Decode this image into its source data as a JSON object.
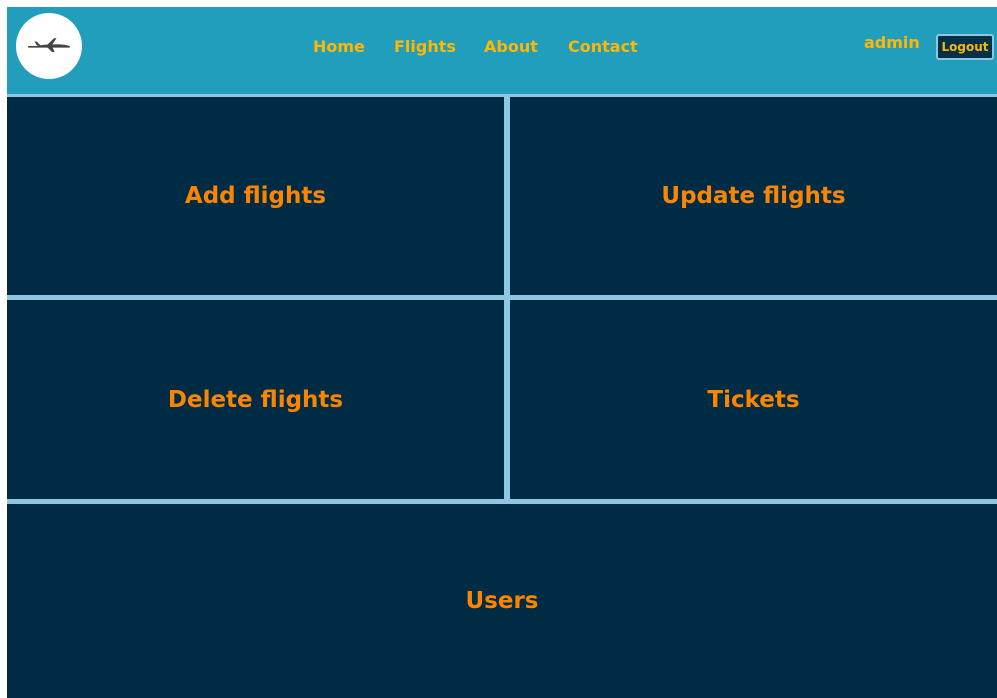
{
  "navbar": {
    "logo_icon": "airplane-icon",
    "links": [
      {
        "label": "Home"
      },
      {
        "label": "Flights"
      },
      {
        "label": "About"
      },
      {
        "label": "Contact"
      }
    ],
    "username": "admin",
    "logout_label": "Logout"
  },
  "tiles": {
    "add": "Add flights",
    "update": "Update flights",
    "delete": "Delete flights",
    "tickets": "Tickets",
    "users": "Users"
  },
  "colors": {
    "navbar_bg": "#219ebc",
    "nav_text": "#ffb703",
    "tile_bg": "#002b44",
    "tile_text": "#fb8500",
    "divider": "#8fc6e4"
  }
}
